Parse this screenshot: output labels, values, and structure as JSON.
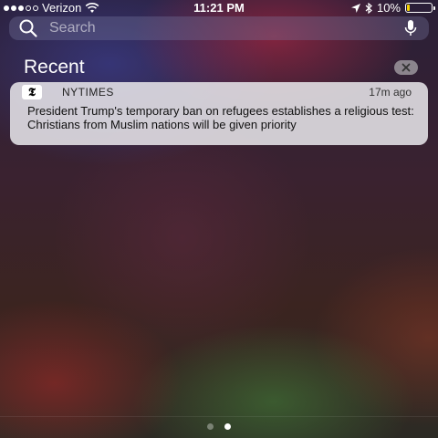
{
  "status_bar": {
    "carrier": "Verizon",
    "time": "11:21 PM",
    "battery_percent": "10%",
    "battery_level": 0.1,
    "signal_bars_filled": 3,
    "signal_bars_total": 5,
    "icons": [
      "wifi-icon",
      "location-icon",
      "bluetooth-icon",
      "battery-icon"
    ]
  },
  "search": {
    "placeholder": "Search",
    "icons": [
      "search-icon",
      "mic-icon"
    ]
  },
  "recent": {
    "title": "Recent",
    "clear_icon": "close-icon"
  },
  "notification": {
    "app_name": "NYTIMES",
    "app_icon_glyph": "𝕿",
    "time_ago": "17m ago",
    "body": "President Trump's temporary ban on refugees establishes a religious test: Christians from Muslim nations will be given priority",
    "colors": {
      "card": "#e6e4e8"
    }
  },
  "page_indicator": {
    "count": 2,
    "active_index": 1
  },
  "colors": {
    "battery": "#f5d200"
  }
}
